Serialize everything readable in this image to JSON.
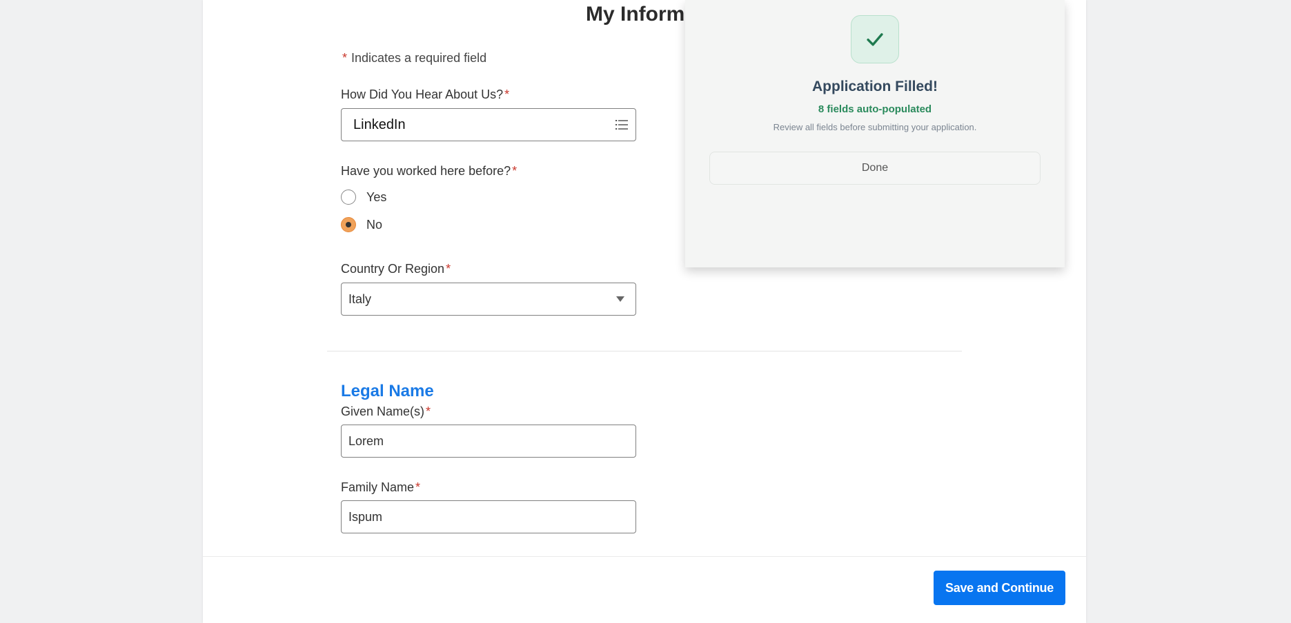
{
  "page": {
    "title": "My Informat",
    "required_note_star": "*",
    "required_note": "Indicates a required field"
  },
  "form": {
    "source": {
      "label": "How Did You Hear About Us?",
      "value": "LinkedIn"
    },
    "worked_before": {
      "label": "Have you worked here before?",
      "options": [
        {
          "label": "Yes",
          "checked": false
        },
        {
          "label": "No",
          "checked": true
        }
      ]
    },
    "country": {
      "label": "Country Or Region",
      "value": "Italy"
    },
    "legal_name": {
      "section_title": "Legal Name",
      "given": {
        "label": "Given Name(s)",
        "value": "Lorem"
      },
      "family": {
        "label": "Family Name",
        "value": "Ispum"
      }
    },
    "required_star": "*"
  },
  "footer": {
    "save_label": "Save and Continue"
  },
  "popup": {
    "title": "Application Filled!",
    "count_text": "8 fields auto-populated",
    "hint": "Review all fields before submitting your application.",
    "done_label": "Done"
  },
  "icons": {
    "list": "list-icon",
    "caret": "caret-down-icon",
    "check": "check-icon"
  },
  "colors": {
    "accent": "#0875f0",
    "section_title": "#1a7ae6",
    "required": "#c9372c",
    "radio_selected": "#f0a25a",
    "success": "#2a8a5c"
  }
}
